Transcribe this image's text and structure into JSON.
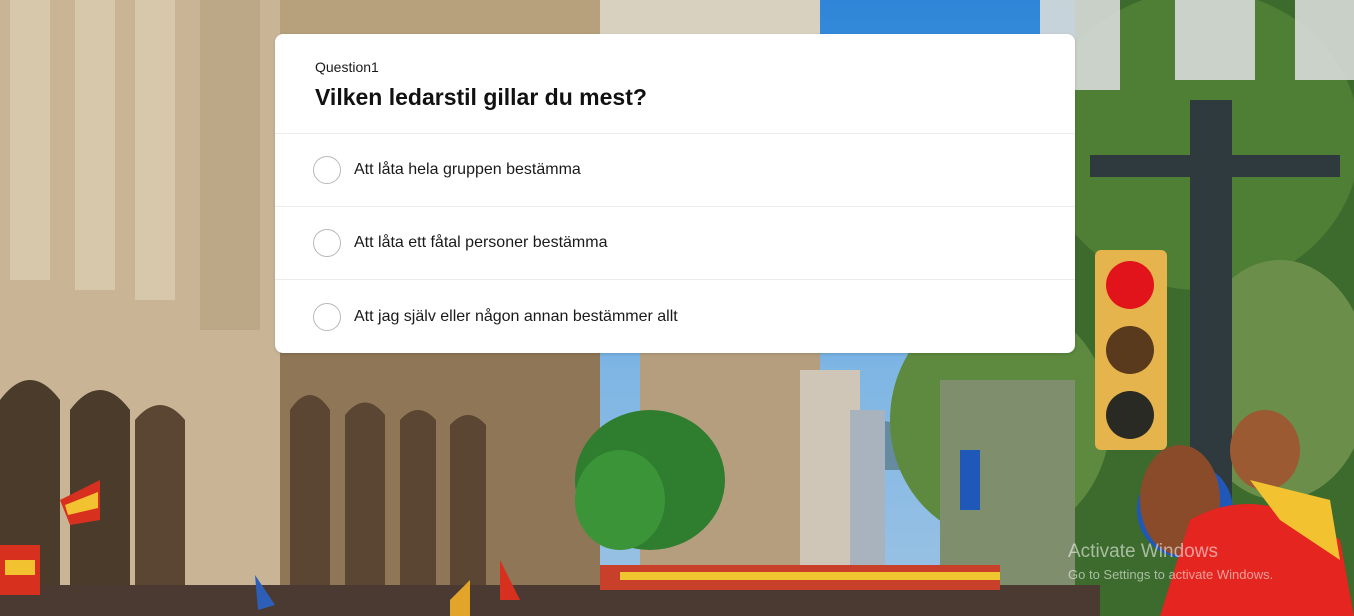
{
  "question": {
    "number_label": "Question1",
    "title": "Vilken ledarstil gillar du mest?"
  },
  "options": [
    {
      "label": "Att låta hela gruppen bestämma"
    },
    {
      "label": "Att låta ett fåtal personer bestämma"
    },
    {
      "label": "Att jag själv eller någon annan bestämmer allt"
    }
  ],
  "watermark": {
    "title": "Activate Windows",
    "subtitle": "Go to Settings to activate Windows."
  },
  "colors": {
    "card_background": "#ffffff",
    "radio_border": "#b9b9b9",
    "sky": "#2f86d8"
  }
}
